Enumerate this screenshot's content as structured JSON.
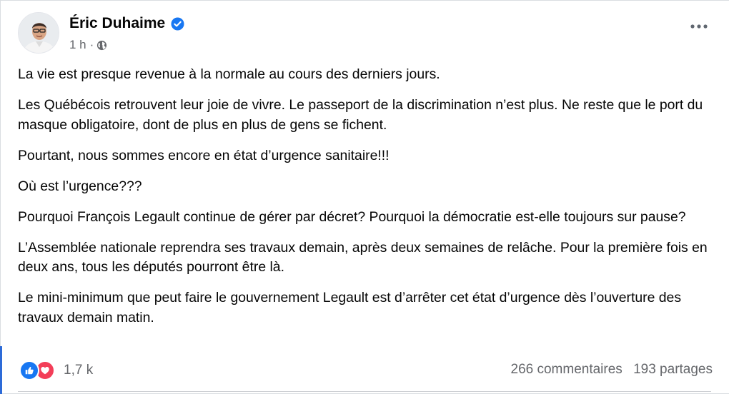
{
  "post": {
    "author": {
      "name": "Éric Duhaime",
      "verified": true,
      "avatar_icon": "person-avatar-icon"
    },
    "timestamp": "1 h",
    "meta_separator": "·",
    "audience_icon": "globe-icon",
    "menu_icon": "more-horizontal-icon",
    "paragraphs": [
      "La vie est presque revenue à la normale au cours des derniers jours.",
      "Les Québécois retrouvent leur joie de vivre. Le passeport de la discrimination n’est plus. Ne reste que le port du masque obligatoire, dont de plus en plus de gens se fichent.",
      "Pourtant, nous sommes encore en état d’urgence sanitaire!!!",
      "Où est l’urgence???",
      "Pourquoi François Legault continue de gérer par décret? Pourquoi la démocratie est-elle toujours sur pause?",
      "L’Assemblée nationale reprendra ses travaux demain, après deux semaines de relâche. Pour la première fois en deux ans, tous les députés pourront être là.",
      "Le mini-minimum que peut faire le gouvernement Legault est d’arrêter cet état d’urgence dès l’ouverture des travaux demain matin."
    ],
    "reactions": {
      "icons": [
        "like-icon",
        "love-icon"
      ],
      "count": "1,7 k"
    },
    "stats": {
      "comments": "266 commentaires",
      "shares": "193 partages"
    }
  },
  "colors": {
    "like": "#1877f2",
    "love": "#f33e58",
    "verified": "#1877f2",
    "secondary_text": "#65676b"
  }
}
